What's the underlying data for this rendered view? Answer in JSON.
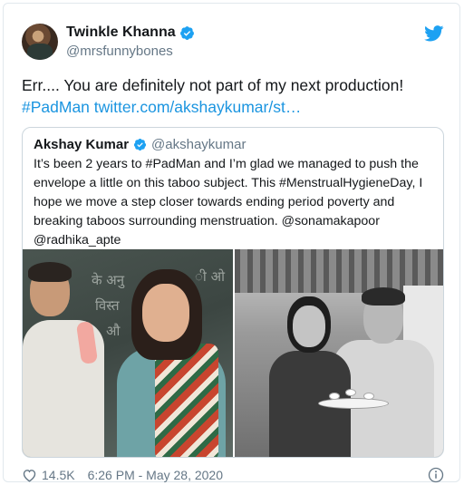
{
  "tweet": {
    "author": {
      "name": "Twinkle Khanna",
      "handle": "@mrsfunnybones",
      "verified": true
    },
    "text_main": "Err.... You are definitely not part of my next production!",
    "text_hashtag": "#PadMan",
    "text_link": "twitter.com/akshaykumar/st…",
    "quoted": {
      "author": {
        "name": "Akshay Kumar",
        "handle": "@akshaykumar",
        "verified": true
      },
      "text": "It’s been 2 years to #PadMan and I’m glad we managed to push the envelope a little on this taboo subject. This #MenstrualHygieneDay, I hope we move a step closer towards ending period poverty and breaking taboos surrounding menstruation. @sonamakapoor @radhika_apte"
    },
    "likes": "14.5K",
    "timestamp": "6:26 PM - May 28, 2020"
  },
  "icons": {
    "brand": "twitter-bird-icon",
    "verified": "verified-badge-icon",
    "like": "heart-icon",
    "info": "info-icon"
  },
  "colors": {
    "brand_blue": "#1DA1F2",
    "link": "#1b95e0",
    "secondary_text": "#657786",
    "border": "#e1e8ed"
  }
}
